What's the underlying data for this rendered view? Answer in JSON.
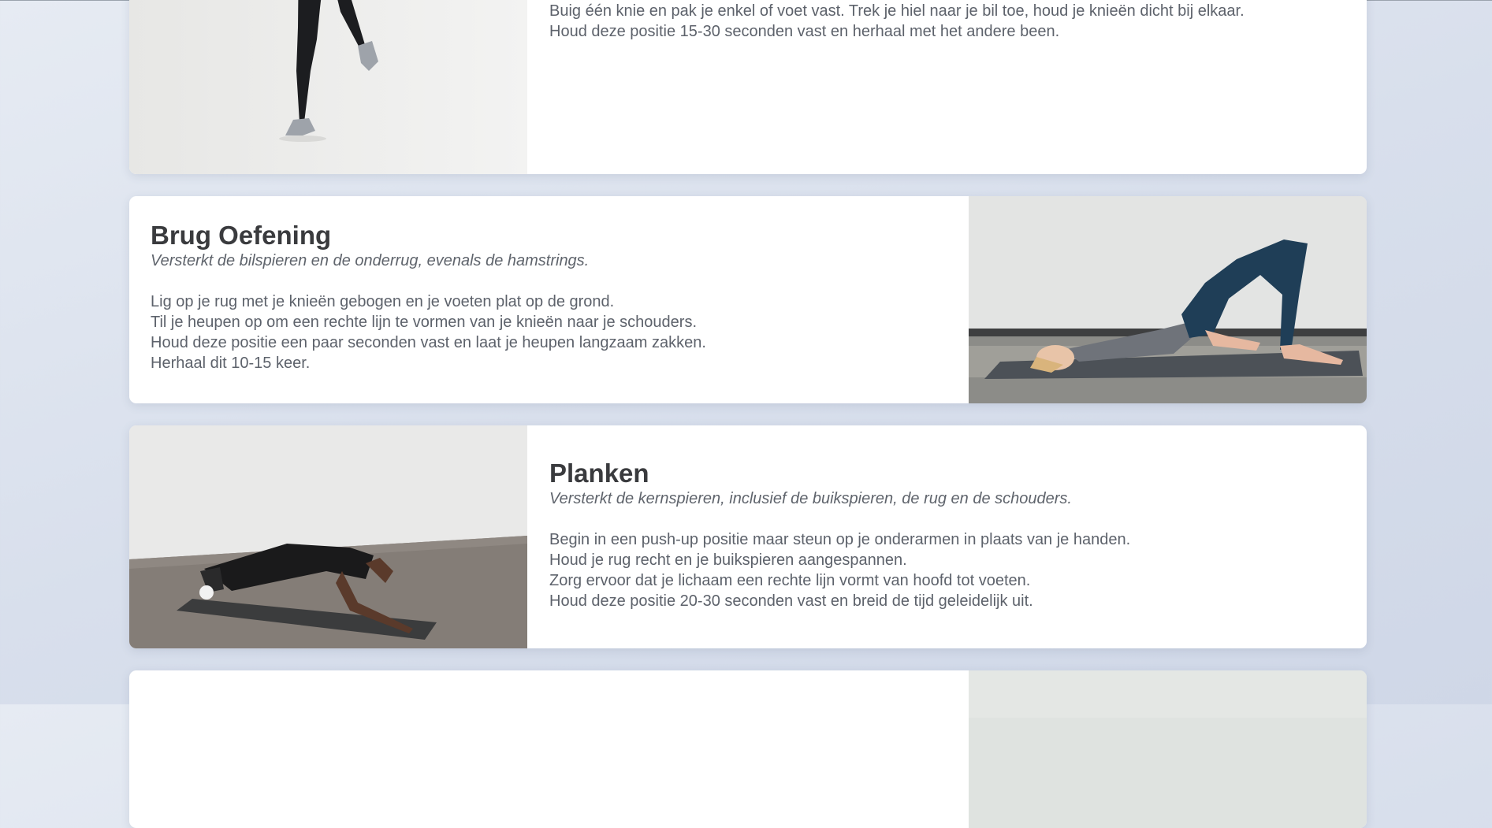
{
  "exercises": [
    {
      "id": "quad-stretch",
      "title": "",
      "subtitle": "",
      "steps": [
        "Buig één knie en pak je enkel of voet vast. Trek je hiel naar je bil toe, houd je knieën dicht bij elkaar.",
        "Houd deze positie 15-30 seconden vast en herhaal met het andere been."
      ]
    },
    {
      "id": "bridge",
      "title": "Brug Oefening",
      "subtitle": "Versterkt de bilspieren en de onderrug, evenals de hamstrings.",
      "steps": [
        "Lig op je rug met je knieën gebogen en je voeten plat op de grond.",
        "Til je heupen op om een rechte lijn te vormen van je knieën naar je schouders.",
        "Houd deze positie een paar seconden vast en laat je heupen langzaam zakken.",
        "Herhaal dit 10-15 keer."
      ]
    },
    {
      "id": "plank",
      "title": "Planken",
      "subtitle": "Versterkt de kernspieren, inclusief de buikspieren, de rug en de schouders.",
      "steps": [
        "Begin in een push-up positie maar steun op je onderarmen in plaats van je handen.",
        "Houd je rug recht en je buikspieren aangespannen.",
        "Zorg ervoor dat je lichaam een rechte lijn vormt van hoofd tot voeten.",
        "Houd deze positie 20-30 seconden vast en breid de tijd geleidelijk uit."
      ]
    }
  ]
}
